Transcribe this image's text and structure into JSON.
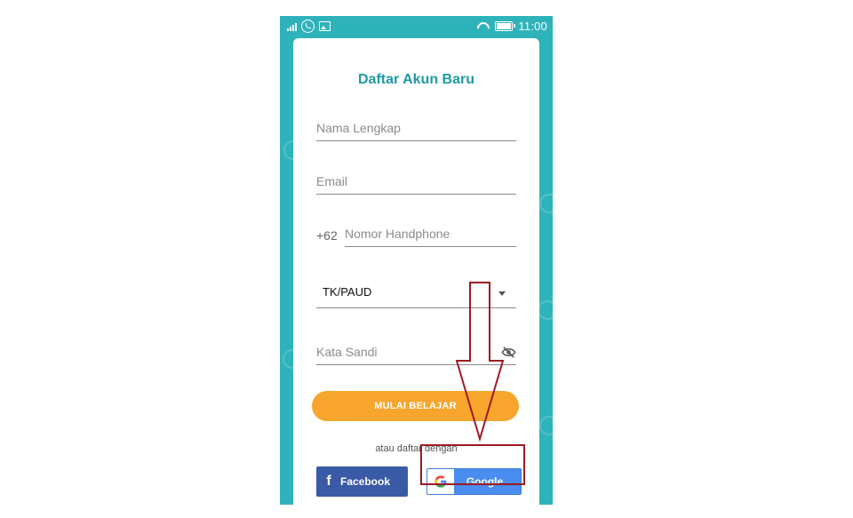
{
  "status_bar": {
    "time": "11:00",
    "icons": [
      "signal-icon",
      "whatsapp-icon",
      "image-icon",
      "wifi-icon",
      "battery-icon"
    ]
  },
  "form": {
    "title": "Daftar Akun Baru",
    "name_placeholder": "Nama Lengkap",
    "email_placeholder": "Email",
    "phone_prefix": "+62",
    "phone_placeholder": "Nomor Handphone",
    "grade_selected": "TK/PAUD",
    "password_placeholder": "Kata Sandi",
    "submit_label": "MULAI BELAJAR",
    "alt_signup_text": "atau daftar dengan",
    "facebook_label": "Facebook",
    "google_label": "Google"
  },
  "colors": {
    "frame": "#2fb3bb",
    "title": "#1f9aa6",
    "primary_button": "#f7a52c",
    "facebook": "#3b5aa5",
    "google": "#4a8cf0",
    "annotation": "#9d1a23"
  }
}
